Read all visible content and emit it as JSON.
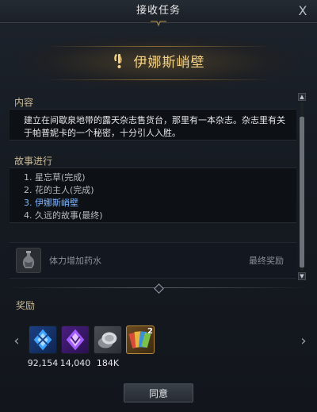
{
  "window": {
    "title": "接收任务",
    "close_glyph": "X",
    "close_icon": "close-icon"
  },
  "quest": {
    "title": "伊娜斯峭壁",
    "icon": "quest-exclamation-icon",
    "accent_color": "#f3d184"
  },
  "content": {
    "label": "内容",
    "description_line1": "建立在间歇泉地带的露天杂志售货台，那里有一本杂志。杂志里有关",
    "description_line2": "于帕普妮卡的一个秘密，十分引人入胜。"
  },
  "story": {
    "label": "故事进行",
    "items": [
      {
        "text": "1. 星忘草(完成)"
      },
      {
        "text": "2. 花的主人(完成)"
      },
      {
        "text": "3. 伊娜斯峭壁",
        "current": true
      },
      {
        "text": "4. 久远的故事(最终)"
      }
    ],
    "current_color": "#7fb6ff"
  },
  "final_reward": {
    "item_name": "体力增加药水",
    "item_icon": "potion-bag-icon",
    "label": "最终奖励"
  },
  "rewards": {
    "label": "奖励",
    "items": [
      {
        "icon": "blue-crystal-icon",
        "qty": "92,154"
      },
      {
        "icon": "purple-crystal-icon",
        "qty": "14,040"
      },
      {
        "icon": "silver-coin-icon",
        "qty": "184K"
      },
      {
        "icon": "card-pack-icon",
        "qty": "",
        "badge": "2"
      }
    ],
    "prev_icon": "chevron-left-icon",
    "next_icon": "chevron-right-icon"
  },
  "actions": {
    "agree_label": "同意"
  }
}
